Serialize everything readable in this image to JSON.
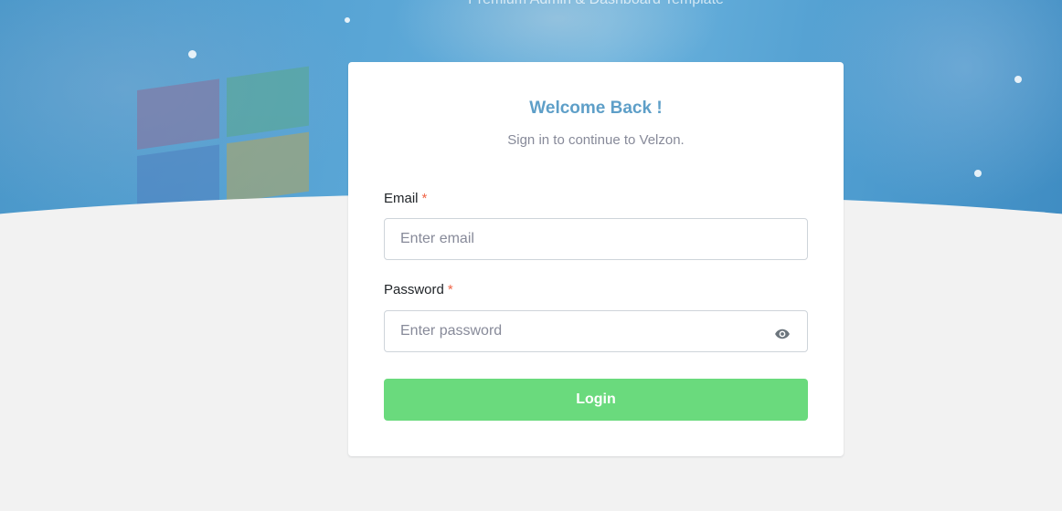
{
  "hero": {
    "tagline": "Premium Admin & Dashboard Template"
  },
  "auth": {
    "welcome_title": "Welcome Back !",
    "subtitle": "Sign in to continue to Velzon.",
    "email": {
      "label": "Email",
      "required_mark": "*",
      "placeholder": "Enter email",
      "value": ""
    },
    "password": {
      "label": "Password",
      "required_mark": "*",
      "placeholder": "Enter password",
      "value": "",
      "toggle_icon": "eye-icon"
    },
    "login_label": "Login"
  },
  "colors": {
    "hero_blue": "#5aa6d6",
    "title_blue": "#5e9fc8",
    "login_green": "#6ada7d",
    "required_red": "#f06548",
    "page_bg": "#f2f2f2"
  }
}
